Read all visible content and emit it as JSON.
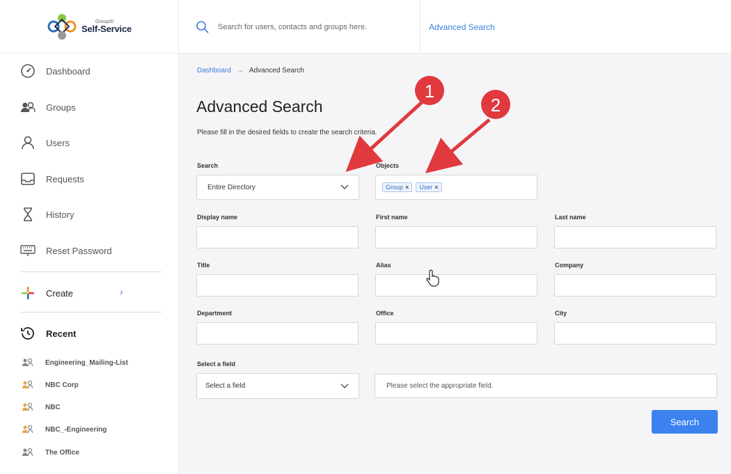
{
  "app": {
    "logo_small": "GroupID",
    "logo_big": "Self-Service"
  },
  "topbar": {
    "search_placeholder": "Search for users, contacts and groups here.",
    "advanced_link": "Advanced Search"
  },
  "sidebar": {
    "items": [
      {
        "label": "Dashboard",
        "icon": "dashboard-icon"
      },
      {
        "label": "Groups",
        "icon": "groups-icon"
      },
      {
        "label": "Users",
        "icon": "user-icon"
      },
      {
        "label": "Requests",
        "icon": "inbox-icon"
      },
      {
        "label": "History",
        "icon": "hourglass-icon"
      },
      {
        "label": "Reset Password",
        "icon": "keyboard-icon"
      }
    ],
    "create_label": "Create",
    "recent_label": "Recent",
    "recent_items": [
      {
        "label": "Engineering_Mailing-List",
        "icon": "group-icon"
      },
      {
        "label": "NBC Corp",
        "icon": "group-icon"
      },
      {
        "label": "NBC",
        "icon": "group-icon"
      },
      {
        "label": "NBC_-Engineering",
        "icon": "group-icon"
      },
      {
        "label": "The Office",
        "icon": "group-icon"
      }
    ]
  },
  "breadcrumb": {
    "home": "Dashboard",
    "current": "Advanced Search"
  },
  "page": {
    "title": "Advanced Search",
    "description": "Please fill in the desired fields to create the search criteria."
  },
  "form": {
    "search_label": "Search",
    "search_value": "Entire Directory",
    "objects_label": "Objects",
    "objects_tags": [
      "Group",
      "User"
    ],
    "display_name_label": "Display name",
    "first_name_label": "First name",
    "last_name_label": "Last name",
    "title_label": "Title",
    "alias_label": "Alias",
    "company_label": "Company",
    "department_label": "Department",
    "office_label": "Office",
    "city_label": "City",
    "select_field_label": "Select a field",
    "select_field_value": "Select a field",
    "select_field_hint": "Please select the appropriate field.",
    "search_button": "Search"
  },
  "annotations": {
    "marker_1": "1",
    "marker_2": "2",
    "marker_color": "#e0393e"
  },
  "colors": {
    "accent": "#3b7ddd",
    "button": "#3b82f0"
  }
}
